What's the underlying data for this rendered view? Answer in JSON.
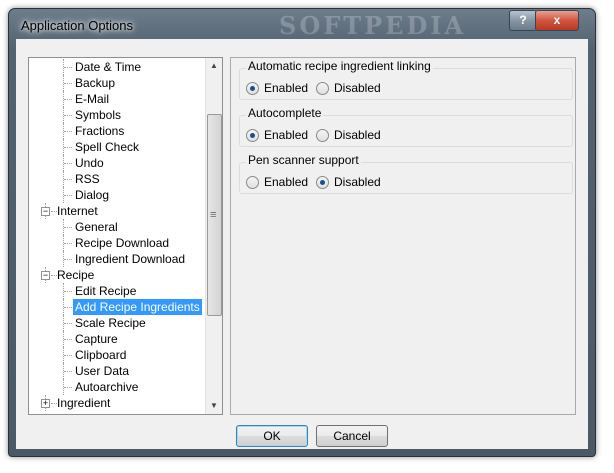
{
  "window": {
    "title": "Application Options",
    "watermark": "SOFTPEDIA",
    "help": "?",
    "close": "x"
  },
  "tree": [
    {
      "label": "Date & Time",
      "level": 2
    },
    {
      "label": "Backup",
      "level": 2
    },
    {
      "label": "E-Mail",
      "level": 2
    },
    {
      "label": "Symbols",
      "level": 2
    },
    {
      "label": "Fractions",
      "level": 2
    },
    {
      "label": "Spell Check",
      "level": 2
    },
    {
      "label": "Undo",
      "level": 2
    },
    {
      "label": "RSS",
      "level": 2
    },
    {
      "label": "Dialog",
      "level": 2
    },
    {
      "label": "Internet",
      "level": 1,
      "expander": "−"
    },
    {
      "label": "General",
      "level": 2
    },
    {
      "label": "Recipe Download",
      "level": 2
    },
    {
      "label": "Ingredient Download",
      "level": 2
    },
    {
      "label": "Recipe",
      "level": 1,
      "expander": "−"
    },
    {
      "label": "Edit Recipe",
      "level": 2
    },
    {
      "label": "Add Recipe Ingredients",
      "level": 2,
      "selected": true
    },
    {
      "label": "Scale Recipe",
      "level": 2
    },
    {
      "label": "Capture",
      "level": 2
    },
    {
      "label": "Clipboard",
      "level": 2
    },
    {
      "label": "User Data",
      "level": 2
    },
    {
      "label": "Autoarchive",
      "level": 2
    },
    {
      "label": "Ingredient",
      "level": 1,
      "expander": "+"
    }
  ],
  "options": {
    "linking": {
      "title": "Automatic recipe ingredient linking",
      "enabled": "Enabled",
      "disabled": "Disabled",
      "value": "Enabled"
    },
    "autocomplete": {
      "title": "Autocomplete",
      "enabled": "Enabled",
      "disabled": "Disabled",
      "value": "Enabled"
    },
    "pen": {
      "title": "Pen scanner support",
      "enabled": "Enabled",
      "disabled": "Disabled",
      "value": "Disabled"
    }
  },
  "buttons": {
    "ok": "OK",
    "cancel": "Cancel"
  },
  "scrollbar": {
    "up": "▲",
    "down": "▼",
    "grip": "≡"
  }
}
